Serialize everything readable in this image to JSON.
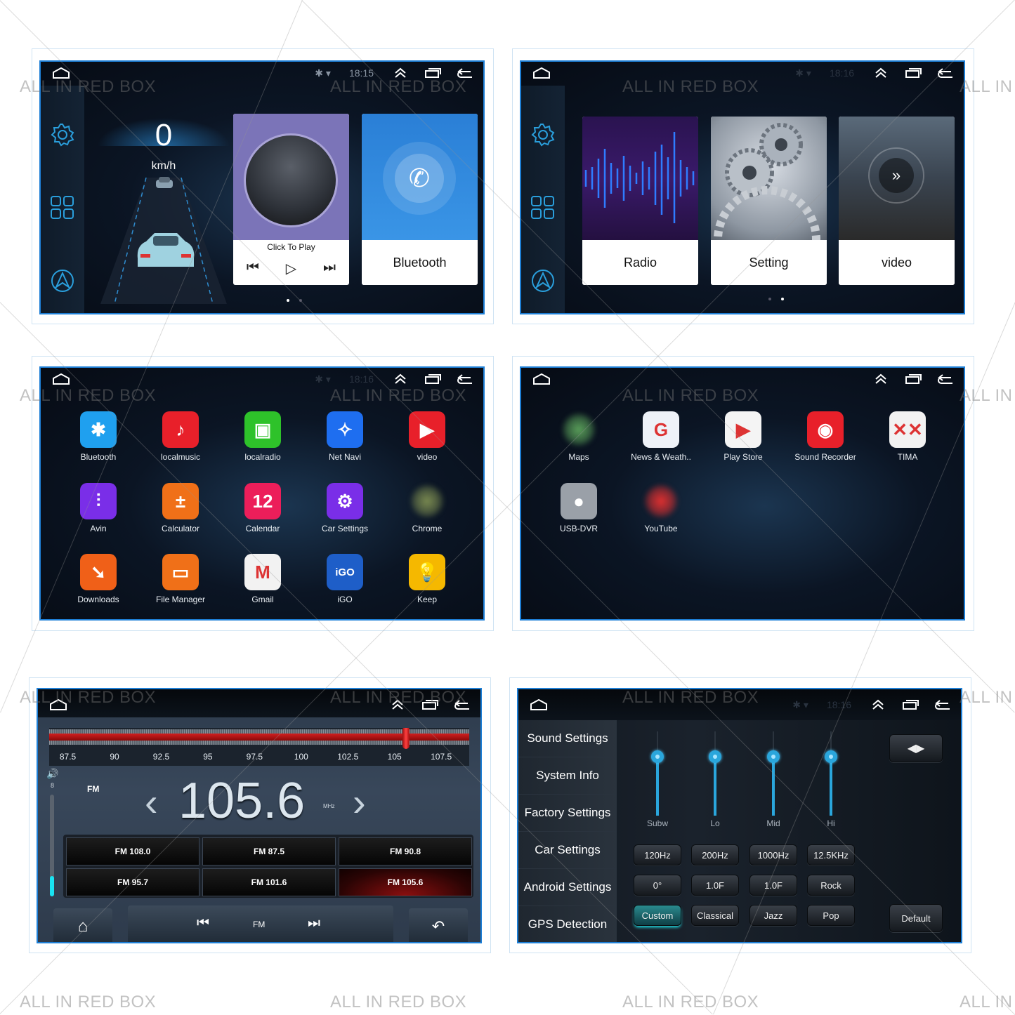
{
  "watermark": "ALL IN RED BOX",
  "status_bar": {
    "time_1": "18:15",
    "time_2": "18:16",
    "time_3": "18:16",
    "time_6": "18:16"
  },
  "panel1": {
    "speed_value": "0",
    "speed_unit": "km/h",
    "music_card": {
      "label": "Click To Play"
    },
    "bluetooth_card": {
      "label": "Bluetooth"
    },
    "page_indicator": {
      "pages": 2,
      "current": 1
    }
  },
  "panel2": {
    "cards": [
      {
        "label": "Radio"
      },
      {
        "label": "Setting"
      },
      {
        "label": "video"
      }
    ],
    "page_indicator": {
      "pages": 2,
      "current": 2
    }
  },
  "panel3": {
    "apps": [
      {
        "label": "Bluetooth",
        "icon": "bluetooth-icon",
        "color": "#1fa0ef",
        "glyph": "✱"
      },
      {
        "label": "localmusic",
        "icon": "music-note-icon",
        "color": "#e8202a",
        "glyph": "♪"
      },
      {
        "label": "localradio",
        "icon": "radio-icon",
        "color": "#2ec22a",
        "glyph": "▣"
      },
      {
        "label": "Net Navi",
        "icon": "compass-icon",
        "color": "#1e6ef0",
        "glyph": "✧"
      },
      {
        "label": "video",
        "icon": "play-circle-icon",
        "color": "#e8202a",
        "glyph": "▶"
      },
      {
        "label": "Avin",
        "icon": "equalizer-icon",
        "color": "#7a2ee8",
        "glyph": "⫶"
      },
      {
        "label": "Calculator",
        "icon": "calculator-icon",
        "color": "#f07018",
        "glyph": "±"
      },
      {
        "label": "Calendar",
        "icon": "calendar-icon",
        "color": "#ec1e5a",
        "glyph": "12"
      },
      {
        "label": "Car Settings",
        "icon": "gear-icon",
        "color": "#7a2ee8",
        "glyph": "⚙"
      },
      {
        "label": "Chrome",
        "icon": "chrome-icon",
        "color": "#7a8a50",
        "glyph": ""
      },
      {
        "label": "Downloads",
        "icon": "download-icon",
        "color": "#f06018",
        "glyph": "➘"
      },
      {
        "label": "File Manager",
        "icon": "folder-icon",
        "color": "#f07018",
        "glyph": "▭"
      },
      {
        "label": "Gmail",
        "icon": "gmail-icon",
        "color": "#f2f2f2",
        "glyph": "M"
      },
      {
        "label": "iGO",
        "icon": "igo-icon",
        "color": "#1e5ec8",
        "glyph": "iGO"
      },
      {
        "label": "Keep",
        "icon": "lightbulb-icon",
        "color": "#f5b800",
        "glyph": "💡"
      }
    ]
  },
  "panel4": {
    "apps": [
      {
        "label": "Maps",
        "icon": "maps-icon",
        "color": "#5aa05a",
        "glyph": ""
      },
      {
        "label": "News & Weath..",
        "icon": "news-icon",
        "color": "#eef2f8",
        "glyph": "G"
      },
      {
        "label": "Play Store",
        "icon": "play-store-icon",
        "color": "#f4f4f4",
        "glyph": "▶"
      },
      {
        "label": "Sound Recorder",
        "icon": "record-icon",
        "color": "#e8202a",
        "glyph": "◉"
      },
      {
        "label": "TIMA",
        "icon": "tima-icon",
        "color": "#f2f2f2",
        "glyph": "✕✕"
      },
      {
        "label": "USB-DVR",
        "icon": "camera-lens-icon",
        "color": "#9aa0a8",
        "glyph": "●"
      },
      {
        "label": "YouTube",
        "icon": "youtube-icon",
        "color": "#e03030",
        "glyph": ""
      }
    ]
  },
  "panel5": {
    "scale_ticks": [
      "87.5",
      "90",
      "92.5",
      "95",
      "97.5",
      "100",
      "102.5",
      "105",
      "107.5"
    ],
    "band": "FM",
    "frequency": "105.6",
    "unit": "MHz",
    "volume_level": "8",
    "volume_fraction": 0.2,
    "tuner_position_mhz": 105.6,
    "scale_min_mhz": 86.5,
    "scale_max_mhz": 109,
    "presets": [
      "FM 108.0",
      "FM 87.5",
      "FM 90.8",
      "FM 95.7",
      "FM 101.6",
      "FM 105.6"
    ],
    "active_preset": 5,
    "bottom_band_label": "FM"
  },
  "panel6": {
    "menu": [
      "Sound Settings",
      "System Info",
      "Factory Settings",
      "Car Settings",
      "Android Settings",
      "GPS Detection"
    ],
    "sliders": [
      {
        "label": "Subw",
        "level": 0.7
      },
      {
        "label": "Lo",
        "level": 0.7
      },
      {
        "label": "Mid",
        "level": 0.7
      },
      {
        "label": "Hi",
        "level": 0.7
      }
    ],
    "freq_buttons": [
      "120Hz",
      "200Hz",
      "1000Hz",
      "12.5KHz"
    ],
    "value_buttons": [
      "0°",
      "1.0F",
      "1.0F",
      "Rock"
    ],
    "preset_buttons": [
      "Custom",
      "Classical",
      "Jazz",
      "Pop"
    ],
    "active_preset": 0,
    "default_label": "Default"
  }
}
